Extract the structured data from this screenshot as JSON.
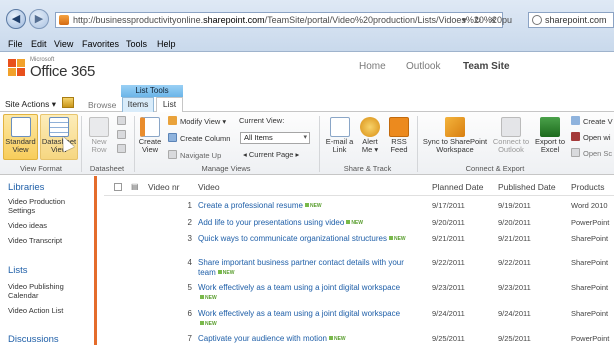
{
  "browser": {
    "url_prefix": "http://businessproductivityonline.",
    "url_domain": "sharepoint.com",
    "url_suffix": "/TeamSite/portal/Video%20production/Lists/Vidoes%20%20pu",
    "search_value": "sharepoint.com",
    "menu": [
      "File",
      "Edit",
      "View",
      "Favorites",
      "Tools",
      "Help"
    ]
  },
  "header": {
    "logo_small": "Microsoft",
    "logo_text": "Office 365",
    "nav": [
      "Home",
      "Outlook",
      "Team Site"
    ]
  },
  "tabs": {
    "site_actions": "Site Actions",
    "browse": "Browse",
    "list_tools": "List Tools",
    "items": "Items",
    "list": "List"
  },
  "ribbon": {
    "standard_view": "Standard View",
    "datasheet_view": "Datasheet View",
    "new_row": "New Row",
    "create_view": "Create View",
    "modify_view": "Modify View",
    "create_column": "Create Column",
    "navigate_up": "Navigate Up",
    "current_view_label": "Current View:",
    "current_view_value": "All Items",
    "current_page": "Current Page",
    "email_link": "E-mail a Link",
    "alert_me": "Alert Me",
    "rss_feed": "RSS Feed",
    "sync_sharepoint": "Sync to SharePoint Workspace",
    "connect_outlook": "Connect to Outlook",
    "export_excel": "Export to Excel",
    "create_v": "Create V",
    "open_wi": "Open wi",
    "open_sc": "Open Sc",
    "groups": {
      "view_format": "View Format",
      "datasheet": "Datasheet",
      "manage_views": "Manage Views",
      "share_track": "Share & Track",
      "connect_export": "Connect & Export"
    },
    "colors": {
      "accent_orange": "#e46c2b",
      "link_blue": "#1f5fa8",
      "selected": "#f8cd5b"
    }
  },
  "quicklaunch": {
    "libraries": "Libraries",
    "library_items": [
      "Video Production Settings",
      "Video ideas",
      "Video Transcript"
    ],
    "lists": "Lists",
    "list_items": [
      "Video Publishing Calendar",
      "Video Action List"
    ],
    "discussions": "Discussions"
  },
  "grid": {
    "columns": [
      "Video nr",
      "Video",
      "Planned Date",
      "Published Date",
      "Products"
    ],
    "new_label": "NEW",
    "rows": [
      {
        "num": "1",
        "title": "Create a professional resume",
        "planned": "9/17/2011",
        "published": "9/19/2011",
        "product": "Word 2010"
      },
      {
        "num": "2",
        "title": "Add life to your presentations using video",
        "planned": "9/20/2011",
        "published": "9/20/2011",
        "product": "PowerPoint"
      },
      {
        "num": "3",
        "title": "Quick ways to communicate organizational structures",
        "planned": "9/21/2011",
        "published": "9/21/2011",
        "product": "SharePoint"
      },
      {
        "num": "4",
        "title": "Share important business partner contact details with your team",
        "planned": "9/22/2011",
        "published": "9/22/2011",
        "product": "SharePoint"
      },
      {
        "num": "5",
        "title": "Work effectively as a team using a joint digital workspace",
        "planned": "9/23/2011",
        "published": "9/23/2011",
        "product": "SharePoint"
      },
      {
        "num": "6",
        "title": "Work effectively as a team using a joint digital workspace",
        "planned": "9/24/2011",
        "published": "9/24/2011",
        "product": "SharePoint"
      },
      {
        "num": "7",
        "title": "Captivate your audience with motion",
        "planned": "9/25/2011",
        "published": "9/25/2011",
        "product": "PowerPoint"
      }
    ]
  }
}
